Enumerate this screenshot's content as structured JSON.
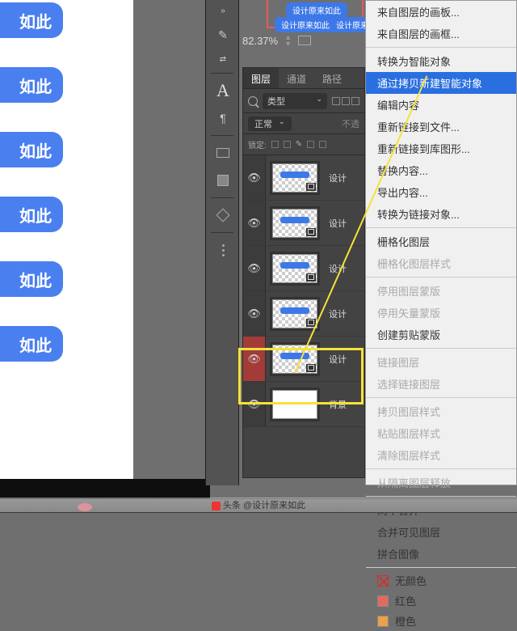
{
  "canvas": {
    "pill_text": "如此"
  },
  "zoom": {
    "value": "82.37%"
  },
  "chips": {
    "c1": "设计原来如此",
    "c2": "设计原来如此",
    "c3": "设计原来如此"
  },
  "panel": {
    "tabs": {
      "layers": "图层",
      "channels": "通道",
      "paths": "路径"
    },
    "filter_label": "类型",
    "mode_label": "正常",
    "opacity_label": "不透",
    "lock_label": "锁定:"
  },
  "layers_list": [
    {
      "name": "设计",
      "visible": true
    },
    {
      "name": "设计",
      "visible": true
    },
    {
      "name": "设计",
      "visible": true
    },
    {
      "name": "设计",
      "visible": true
    },
    {
      "name": "设计",
      "visible": true,
      "selected": true
    },
    {
      "name": "背景",
      "visible": true,
      "white": true
    }
  ],
  "menu": {
    "from_artboard": "来自图层的画板...",
    "from_frame": "来自图层的画框...",
    "convert_so": "转换为智能对象",
    "new_so_copy": "通过拷贝新建智能对象",
    "edit_contents": "编辑内容",
    "relink_file": "重新链接到文件...",
    "relink_lib": "重新链接到库图形...",
    "replace_contents": "替换内容...",
    "export_contents": "导出内容...",
    "convert_linked": "转换为链接对象...",
    "rasterize": "栅格化图层",
    "rasterize_style": "栅格化图层样式",
    "disable_mask": "停用图层蒙版",
    "disable_vmask": "停用矢量蒙版",
    "create_clip": "创建剪贴蒙版",
    "link_layers": "链接图层",
    "select_linked": "选择链接图层",
    "copy_style": "拷贝图层样式",
    "paste_style": "粘贴图层样式",
    "clear_style": "清除图层样式",
    "release_iso": "从隔离图层释放",
    "merge_down": "向下合并",
    "merge_visible": "合并可见图层",
    "flatten": "拼合图像",
    "no_color": "无颜色",
    "red": "红色",
    "orange": "橙色"
  },
  "footer": {
    "text": "头条 @设计原来如此"
  }
}
